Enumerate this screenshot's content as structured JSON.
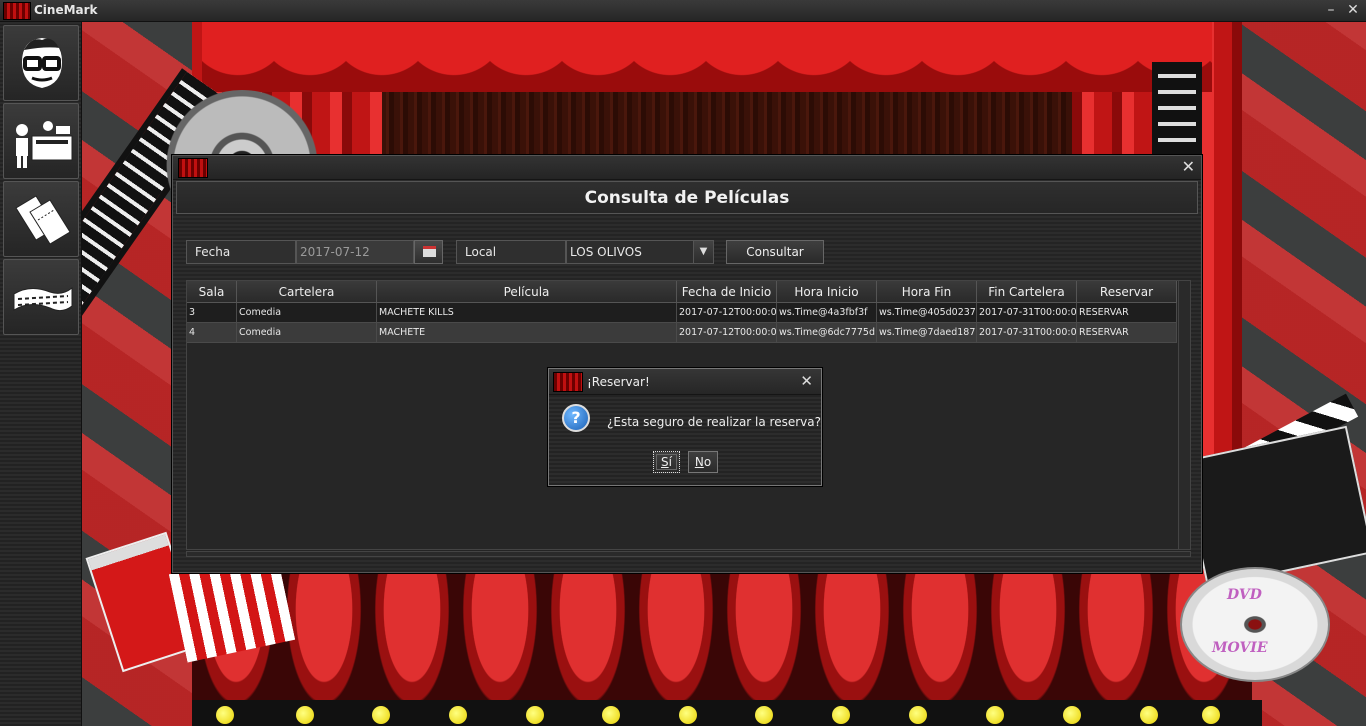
{
  "app": {
    "title": "CineMark",
    "controls": {
      "minimize": "–",
      "close": "✕"
    }
  },
  "sidebar": {
    "items": [
      {
        "icon": "user-glasses-icon"
      },
      {
        "icon": "ticket-counter-icon"
      },
      {
        "icon": "tickets-icon"
      },
      {
        "icon": "film-strip-icon"
      }
    ]
  },
  "background": {
    "dvd_top": "DVD",
    "dvd_bottom": "MOVIE"
  },
  "window": {
    "close": "✕",
    "heading": "Consulta de Películas",
    "filters": {
      "fecha_label": "Fecha",
      "fecha_value": "2017-07-12",
      "local_label": "Local",
      "local_value": "LOS OLIVOS",
      "consultar": "Consultar"
    },
    "table": {
      "columns": [
        "Sala",
        "Cartelera",
        "Película",
        "Fecha de Inicio",
        "Hora Inicio",
        "Hora Fin",
        "Fin Cartelera",
        "Reservar"
      ],
      "rows": [
        [
          "3",
          "Comedia",
          "MACHETE KILLS",
          "2017-07-12T00:00:0...",
          "ws.Time@4a3fbf3f",
          "ws.Time@405d0237",
          "2017-07-31T00:00:0...",
          "RESERVAR"
        ],
        [
          "4",
          "Comedia",
          "MACHETE",
          "2017-07-12T00:00:0...",
          "ws.Time@6dc7775d",
          "ws.Time@7daed187",
          "2017-07-31T00:00:0...",
          "RESERVAR"
        ]
      ]
    }
  },
  "dialog": {
    "title": "¡Reservar!",
    "close": "✕",
    "icon": "question-icon",
    "message": "¿Esta seguro de realizar la reserva?",
    "yes_mnemonic": "S",
    "yes_rest": "í",
    "no_mnemonic": "N",
    "no_rest": "o"
  },
  "colors": {
    "accent_red": "#c01010",
    "frame_bg": "#262626",
    "bulb_yellow": "#e8d000"
  }
}
